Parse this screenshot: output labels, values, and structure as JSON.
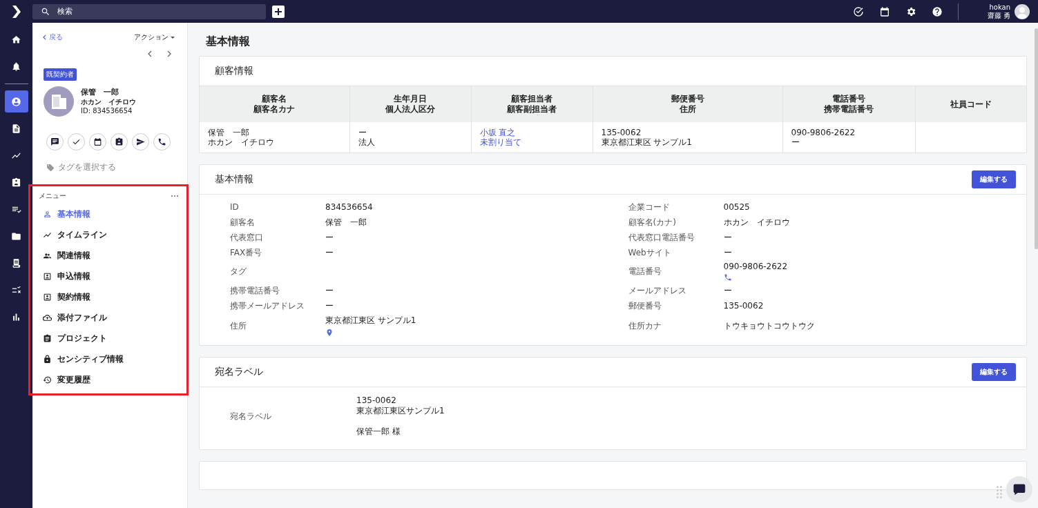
{
  "topbar": {
    "search": {
      "placeholder": "検索"
    },
    "user": {
      "account": "hokan",
      "name": "齋藤 勇"
    }
  },
  "rail": [
    {
      "selected": false
    },
    {
      "selected": false
    },
    {
      "selected": true
    },
    {
      "selected": false
    },
    {
      "selected": false
    },
    {
      "selected": false
    },
    {
      "selected": false
    },
    {
      "selected": false
    },
    {
      "selected": false
    },
    {
      "selected": false
    },
    {
      "selected": false
    }
  ],
  "sidebar": {
    "back": "戻る",
    "actions": "アクション",
    "status_badge": "既契約者",
    "customer": {
      "name": "保管　一郎",
      "kana": "ホカン　イチロウ",
      "id": "ID: 834536654"
    },
    "tag_placeholder": "タグを選択する",
    "menu": {
      "title": "メニュー",
      "highlighted": true,
      "items": [
        {
          "label": "基本情報",
          "selected": true
        },
        {
          "label": "タイムライン",
          "selected": false
        },
        {
          "label": "関連情報",
          "selected": false
        },
        {
          "label": "申込情報",
          "selected": false
        },
        {
          "label": "契約情報",
          "selected": false
        },
        {
          "label": "添付ファイル",
          "selected": false
        },
        {
          "label": "プロジェクト",
          "selected": false
        },
        {
          "label": "センシティブ情報",
          "selected": false
        },
        {
          "label": "変更履歴",
          "selected": false
        }
      ]
    }
  },
  "page_title": "基本情報",
  "customer_card": {
    "title": "顧客情報",
    "columns": [
      [
        "顧客名",
        "顧客名カナ"
      ],
      [
        "生年月日",
        "個人法人区分"
      ],
      [
        "顧客担当者",
        "顧客副担当者"
      ],
      [
        "郵便番号",
        "住所"
      ],
      [
        "電話番号",
        "携帯電話番号"
      ],
      [
        "社員コード"
      ]
    ],
    "row": [
      {
        "lines": [
          "保管　一郎",
          "ホカン　イチロウ"
        ],
        "link": false
      },
      {
        "lines": [
          "ー",
          "法人"
        ],
        "link": false
      },
      {
        "lines": [
          "小坂 直之",
          "未割り当て"
        ],
        "link": true
      },
      {
        "lines": [
          "135-0062",
          "東京都江東区 サンプル1"
        ],
        "link": false
      },
      {
        "lines": [
          "090-9806-2622",
          "ー"
        ],
        "link": false
      }
    ]
  },
  "basic_card": {
    "title": "基本情報",
    "button": "編集する",
    "fields": [
      [
        {
          "kind": "text",
          "label": "ID",
          "value": "834536654"
        },
        {
          "kind": "text",
          "label": "企業コード",
          "value": "00525"
        }
      ],
      [
        {
          "kind": "text",
          "label": "顧客名",
          "value": "保管　一郎"
        },
        {
          "kind": "text",
          "label": "顧客名(カナ)",
          "value": "ホカン　イチロウ"
        }
      ],
      [
        {
          "kind": "text",
          "label": "代表窓口",
          "value": "ー"
        },
        {
          "kind": "text",
          "label": "代表窓口電話番号",
          "value": "ー"
        }
      ],
      [
        {
          "kind": "text",
          "label": "FAX番号",
          "value": "ー"
        },
        {
          "kind": "text",
          "label": "Webサイト",
          "value": "ー"
        }
      ],
      [
        {
          "kind": "text",
          "label": "タグ"
        },
        {
          "kind": "phone",
          "label": "電話番号",
          "value": "090-9806-2622"
        }
      ],
      [
        {
          "kind": "text",
          "label": "携帯電話番号",
          "value": "ー"
        },
        {
          "kind": "text",
          "label": "メールアドレス",
          "value": "ー"
        }
      ],
      [
        {
          "kind": "text",
          "label": "携帯メールアドレス",
          "value": "ー"
        },
        {
          "kind": "text",
          "label": "郵便番号",
          "value": "135-0062"
        }
      ],
      [
        {
          "kind": "address",
          "label": "住所",
          "value": "東京都江東区 サンプル1"
        },
        {
          "kind": "text",
          "label": "住所カナ",
          "value": "トウキョウトコウトウク"
        }
      ]
    ]
  },
  "label_card": {
    "title": "宛名ラベル",
    "button": "編集する",
    "label": "宛名ラベル",
    "address_lines": [
      "135-0062",
      "東京都江東区サンプル1"
    ],
    "addressee": "保管一郎 様"
  }
}
